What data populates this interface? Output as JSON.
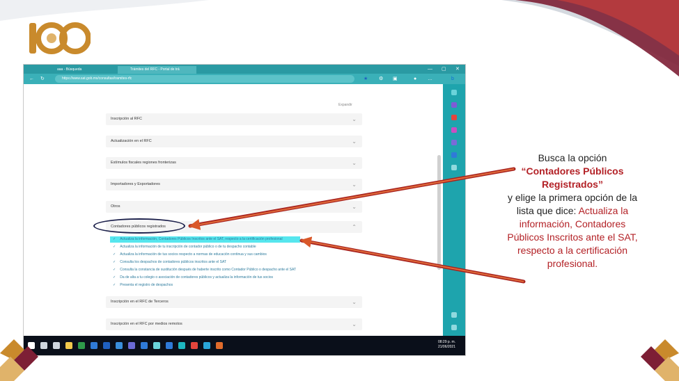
{
  "browser": {
    "tab1_label": "aaa - Búsqueda",
    "tab2_label": "Trámites del RFC - Portal de trá",
    "url": "https://www.sat.gob.mx/consultas/tramites-rfc",
    "minimize": "—",
    "maximize": "▢",
    "close": "✕"
  },
  "page": {
    "collapse_label": "Expandir",
    "accordion": [
      {
        "label": "Inscripción al RFC"
      },
      {
        "label": "Actualización en el RFC"
      },
      {
        "label": "Estímulos fiscales regiones fronterizas"
      },
      {
        "label": "Importadores y Exportadores"
      },
      {
        "label": "Otros"
      },
      {
        "label": "Contadores públicos registrados"
      },
      {
        "label": "Inscripción en el RFC de Terceros"
      },
      {
        "label": "Inscripción en el RFC por medios remotos"
      }
    ],
    "sub_items": [
      "Actualiza la información, Contadores Públicos Inscritos ante el SAT, respecto a la certificación profesional",
      "Actualiza la información de tu inscripción de contador público o de tu despacho contable",
      "Actualiza la información de tus socios respecto a normas de educación continua y sus cambios",
      "Consulta los despachos de contadores públicos inscritos ante el SAT",
      "Consulta la constancia de sustitución después de haberte inscrito como Contador Público o despacho ante el SAT",
      "Da de alta a tu colegio o asociación de contadores públicos y actualiza la información de tus socios",
      "Presenta el registro de despachos"
    ]
  },
  "taskbar": {
    "time": "08:29 p. m.",
    "date": "21/06/2021"
  },
  "callout": {
    "line1": "Busca la opción",
    "line2": "“Contadores Públicos",
    "line3": "Registrados”",
    "line4": "y elige la primera opción de la",
    "line5": "lista que dice: ",
    "line5_red": "Actualiza la",
    "line6": "información, Contadores",
    "line7": "Públicos Inscritos ante el SAT,",
    "line8": "respecto a la certificación",
    "line9": "profesional."
  },
  "colors": {
    "accent_red": "#b32126",
    "browser_teal": "#2a9aa3",
    "highlight": "#56e6ee",
    "logo_gold": "#c98a2c"
  }
}
